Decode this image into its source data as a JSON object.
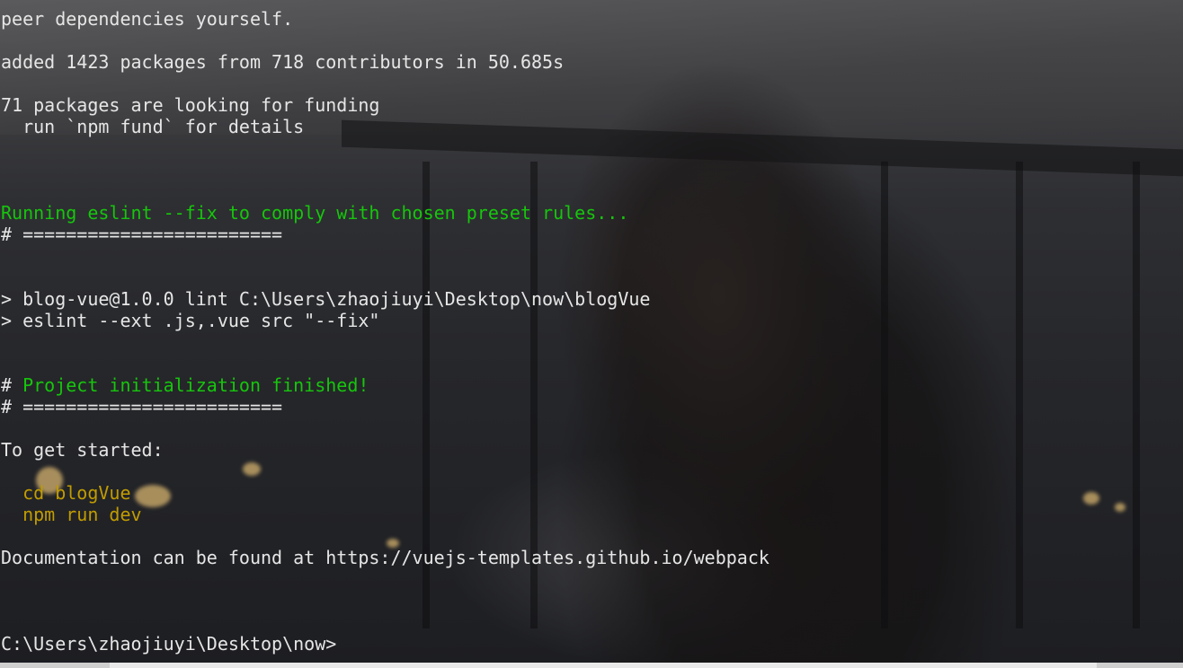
{
  "terminal": {
    "lines": [
      {
        "text": "peer dependencies yourself.",
        "color": "default"
      },
      {
        "text": "",
        "color": "default"
      },
      {
        "text": "added 1423 packages from 718 contributors in 50.685s",
        "color": "default"
      },
      {
        "text": "",
        "color": "default"
      },
      {
        "text": "71 packages are looking for funding",
        "color": "default"
      },
      {
        "text": "  run `npm fund` for details",
        "color": "default"
      },
      {
        "text": "",
        "color": "default"
      },
      {
        "text": "",
        "color": "default"
      },
      {
        "text": "",
        "color": "default"
      },
      {
        "text": "Running eslint --fix to comply with chosen preset rules...",
        "color": "green"
      },
      {
        "text": "# ========================",
        "color": "default"
      },
      {
        "text": "",
        "color": "default"
      },
      {
        "text": "",
        "color": "default"
      },
      {
        "text": "> blog-vue@1.0.0 lint C:\\Users\\zhaojiuyi\\Desktop\\now\\blogVue",
        "color": "default"
      },
      {
        "text": "> eslint --ext .js,.vue src \"--fix\"",
        "color": "default"
      },
      {
        "text": "",
        "color": "default"
      },
      {
        "text": "",
        "color": "default"
      },
      {
        "text": "# ",
        "color": "default",
        "suffix": "Project initialization finished!",
        "suffix_color": "green"
      },
      {
        "text": "# ========================",
        "color": "default"
      },
      {
        "text": "",
        "color": "default"
      },
      {
        "text": "To get started:",
        "color": "default"
      },
      {
        "text": "",
        "color": "default"
      },
      {
        "text": "  cd blogVue",
        "color": "yellow"
      },
      {
        "text": "  npm run dev",
        "color": "yellow"
      },
      {
        "text": "",
        "color": "default"
      },
      {
        "text": "Documentation can be found at https://vuejs-templates.github.io/webpack",
        "color": "default"
      },
      {
        "text": "",
        "color": "default"
      },
      {
        "text": "",
        "color": "default"
      },
      {
        "text": "",
        "color": "default"
      },
      {
        "text": "C:\\Users\\zhaojiuyi\\Desktop\\now>",
        "color": "default"
      }
    ]
  },
  "colors": {
    "default": "#e6e6e6",
    "green": "#16c60c",
    "yellow": "#c19c00"
  }
}
